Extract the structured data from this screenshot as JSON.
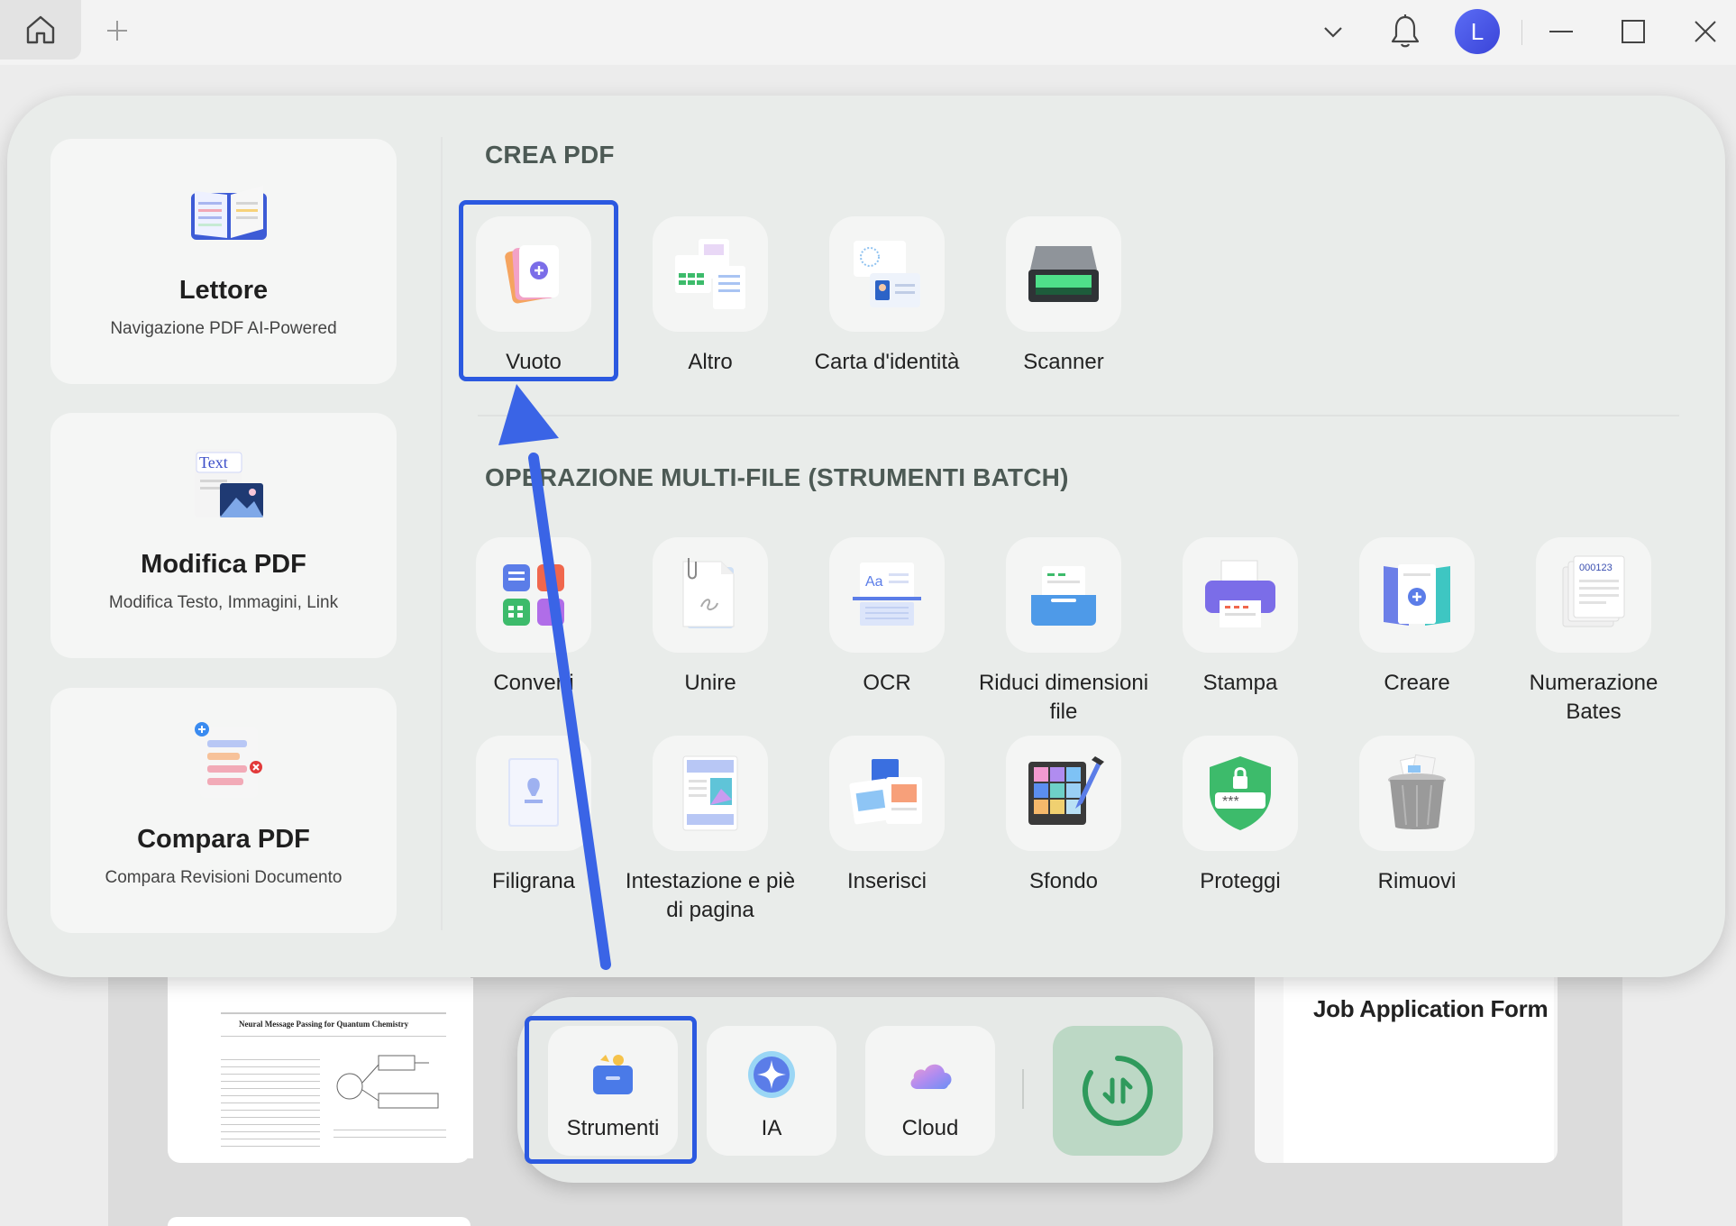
{
  "titlebar": {
    "avatar_letter": "L",
    "icons": [
      "home-icon",
      "plus-icon",
      "chevron-down-icon",
      "bell-icon",
      "minimize-icon",
      "maximize-icon",
      "close-icon"
    ]
  },
  "sidebar": {
    "items": [
      {
        "title": "Lettore",
        "subtitle": "Navigazione PDF AI-Powered",
        "icon": "book-icon"
      },
      {
        "title": "Modifica PDF",
        "subtitle": "Modifica Testo, Immagini, Link",
        "icon": "edit-text-icon",
        "icon_text": "Text"
      },
      {
        "title": "Compara PDF",
        "subtitle": "Compara Revisioni Documento",
        "icon": "compare-icon"
      }
    ]
  },
  "crea_pdf": {
    "title": "CREA PDF",
    "tools": [
      {
        "label": "Vuoto",
        "icon": "blank-doc-icon"
      },
      {
        "label": "Altro",
        "icon": "other-doc-icon"
      },
      {
        "label": "Carta d'identità",
        "icon": "id-card-icon"
      },
      {
        "label": "Scanner",
        "icon": "scanner-icon"
      }
    ]
  },
  "batch": {
    "title": "OPERAZIONE MULTI-FILE (STRUMENTI BATCH)",
    "tools": [
      {
        "label": "Converti",
        "icon": "convert-icon"
      },
      {
        "label": "Unire",
        "icon": "merge-icon"
      },
      {
        "label": "OCR",
        "icon": "ocr-icon"
      },
      {
        "label": "Riduci dimensioni file",
        "icon": "compress-icon"
      },
      {
        "label": "Stampa",
        "icon": "print-icon"
      },
      {
        "label": "Creare",
        "icon": "create-icon"
      },
      {
        "label": "Numerazione Bates",
        "icon": "bates-icon",
        "icon_text": "000123"
      },
      {
        "label": "Filigrana",
        "icon": "watermark-icon"
      },
      {
        "label": "Intestazione e piè di pagina",
        "icon": "header-footer-icon"
      },
      {
        "label": "Inserisci",
        "icon": "insert-icon"
      },
      {
        "label": "Sfondo",
        "icon": "background-icon"
      },
      {
        "label": "Proteggi",
        "icon": "protect-icon",
        "icon_text": "***"
      },
      {
        "label": "Rimuovi",
        "icon": "trash-icon"
      }
    ]
  },
  "dock": {
    "items": [
      {
        "label": "Strumenti",
        "icon": "toolbox-icon"
      },
      {
        "label": "IA",
        "icon": "ai-icon"
      },
      {
        "label": "Cloud",
        "icon": "cloud-icon"
      }
    ],
    "sync_icon": "sync-icon"
  },
  "background_docs": {
    "paper_title": "Neural Message Passing for Quantum Chemistry",
    "form_title": "Job Application Form"
  },
  "colors": {
    "highlight": "#2b59e0",
    "accent_blue": "#3a44d8",
    "sync_green": "#2f9a5c"
  }
}
